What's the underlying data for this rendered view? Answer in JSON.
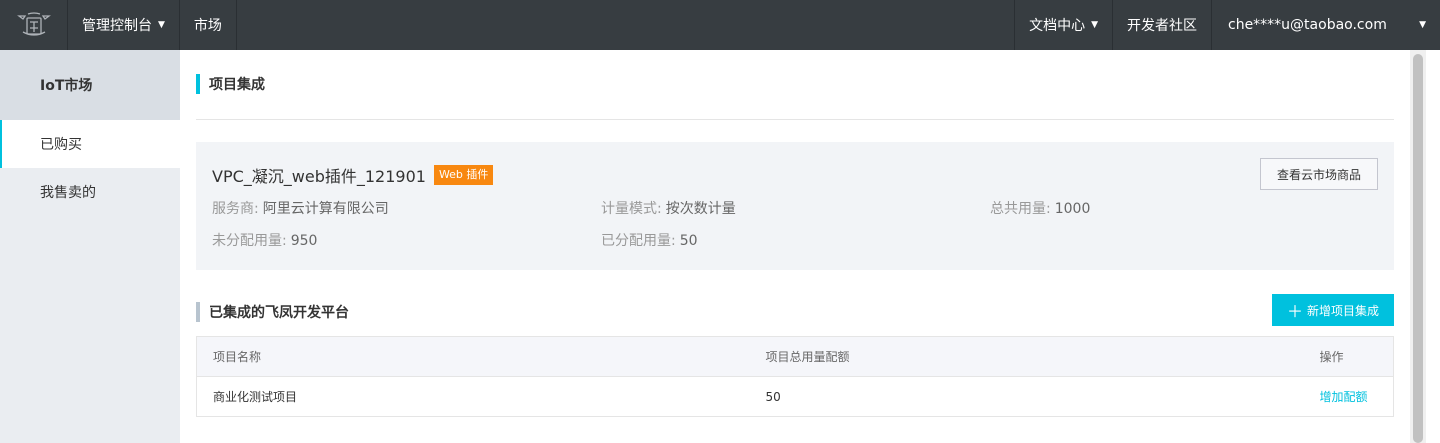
{
  "topbar": {
    "console_label": "管理控制台",
    "market_label": "市场",
    "docs_label": "文档中心",
    "community_label": "开发者社区",
    "account_label": "che****u@taobao.com"
  },
  "sidebar": {
    "header": "IoT市场",
    "items": [
      {
        "label": "已购买"
      },
      {
        "label": "我售卖的"
      }
    ]
  },
  "main": {
    "section_title": "项目集成",
    "product": {
      "name": "VPC_凝沉_web插件_121901",
      "badge": "Web 插件",
      "view_button": "查看云市场商品",
      "provider_label": "服务商:",
      "provider_value": "阿里云计算有限公司",
      "metering_label": "计量模式:",
      "metering_value": "按次数计量",
      "total_label": "总共用量:",
      "total_value": "1000",
      "unallocated_label": "未分配用量:",
      "unallocated_value": "950",
      "allocated_label": "已分配用量:",
      "allocated_value": "50"
    },
    "integrated_title": "已集成的飞凤开发平台",
    "add_button": "新增项目集成",
    "table": {
      "columns": [
        "项目名称",
        "项目总用量配额",
        "操作"
      ],
      "rows": [
        {
          "name": "商业化测试项目",
          "quota": "50",
          "action": "增加配额"
        }
      ]
    }
  },
  "colors": {
    "topbar_bg": "#373d41",
    "accent": "#00c1de",
    "badge_bg": "#f88810",
    "sidebar_bg": "#eaedf1"
  }
}
